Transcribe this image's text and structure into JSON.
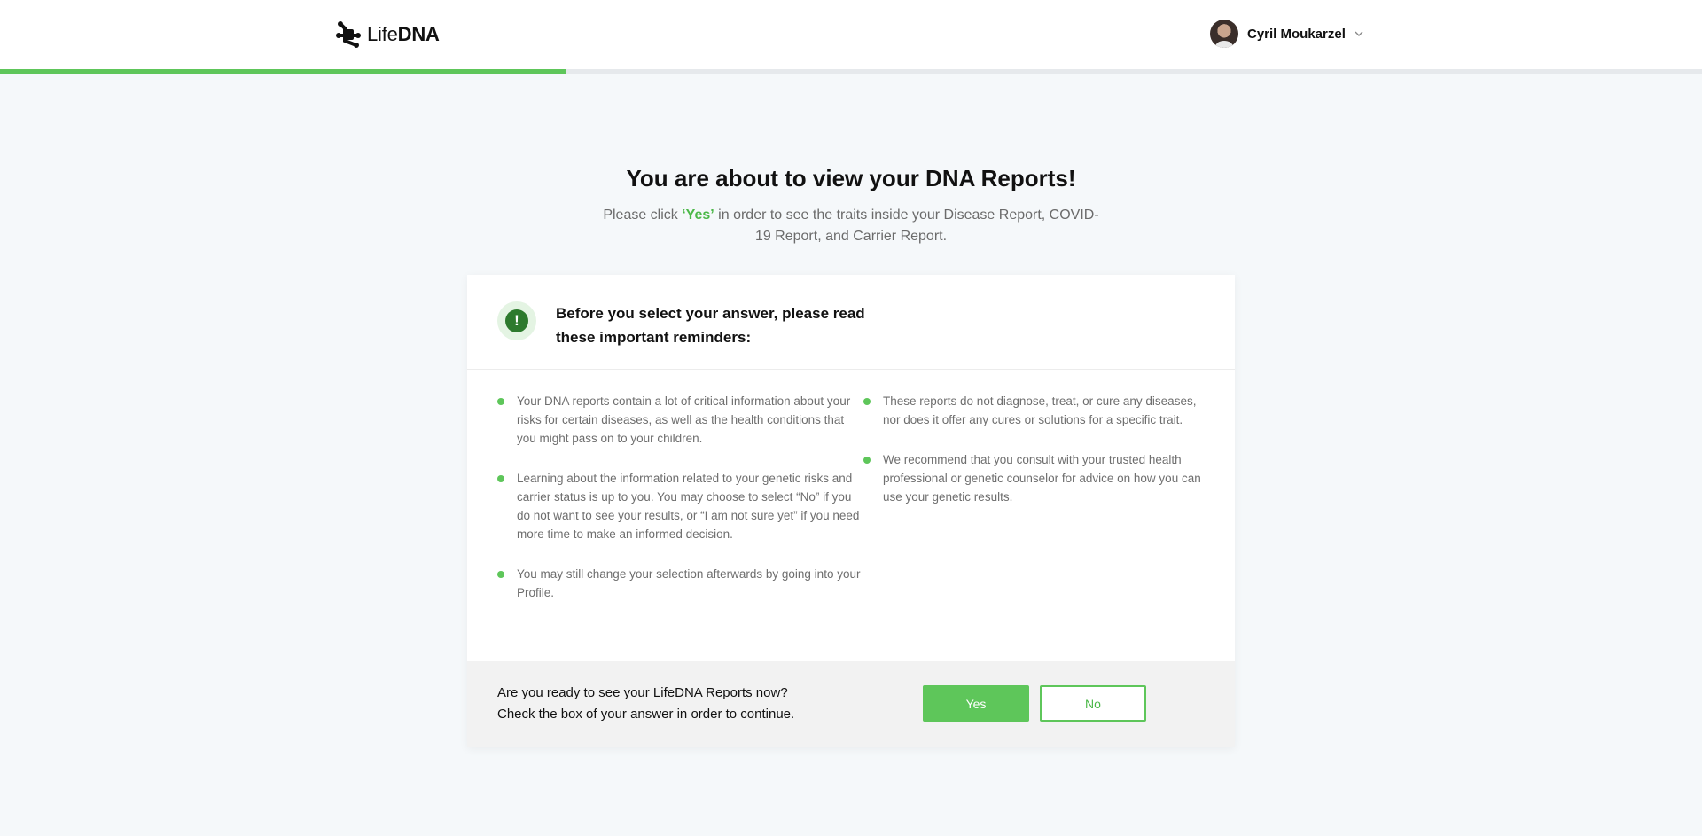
{
  "header": {
    "logo_text_light": "Life",
    "logo_text_bold": "DNA",
    "user_name": "Cyril Moukarzel",
    "progress_percent": 33.3
  },
  "hero": {
    "title": "You are about to view your DNA Reports!",
    "subtitle_pre": "Please click ",
    "subtitle_yes": "‘Yes’",
    "subtitle_post": " in order to see the traits inside your Disease Report, COVID-19 Report, and Carrier Report."
  },
  "card": {
    "heading": "Before you select your answer, please read these important reminders:",
    "left_bullets": [
      "Your DNA reports contain a lot of critical information about your risks for certain diseases, as well as the health conditions that you might pass on to your children.",
      "Learning about the information related to your genetic risks and carrier status is up to you. You may choose to select “No” if you do not want to see your results, or “I am not sure yet” if you need more time to make an informed decision.",
      "You may still change your selection afterwards by going into your Profile."
    ],
    "right_bullets": [
      "These reports do not diagnose, treat, or cure any diseases, nor does it offer any cures or solutions for a specific trait.",
      "We recommend that you consult with your trusted health professional or genetic counselor for advice on how you can use your genetic results."
    ],
    "footer_line1": "Are you ready to see your LifeDNA Reports now?",
    "footer_line2": "Check the box of your answer in order to continue.",
    "yes_label": "Yes",
    "no_label": "No"
  },
  "colors": {
    "accent": "#5ec65a",
    "background": "#f5f8fa"
  }
}
